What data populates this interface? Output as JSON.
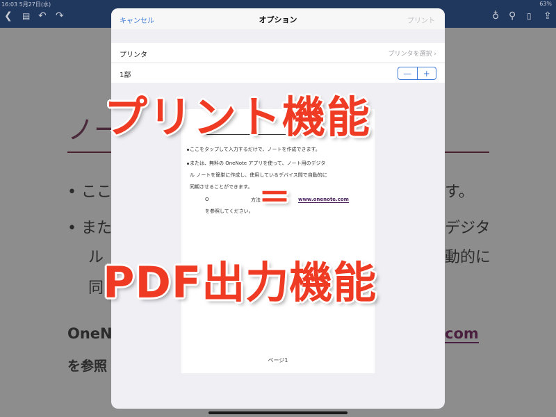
{
  "status_bar": {
    "time_date": "16:03  5月27日(水)",
    "right": "63%"
  },
  "toolbar": {
    "back_icon": "chevron-left-icon",
    "tabs_icon": "tabs-icon",
    "undo_icon": "undo-icon",
    "redo_icon": "redo-icon",
    "bulb_icon": "lightbulb-icon",
    "search_icon": "search-icon",
    "device_icon": "device-icon",
    "share_icon": "share-icon"
  },
  "background_page": {
    "title": "ノー",
    "bullet1_start": "•  ここ",
    "bullet1_end": "す。",
    "bullet2_start": "•  また",
    "bullet2_end": "デジタ",
    "line3_start": "ル",
    "line3_end": "動的に",
    "line4_start": "同",
    "onenote_start": "OneNo",
    "link_end": "com",
    "ref": "を参照"
  },
  "dialog": {
    "cancel": "キャンセル",
    "title": "オプション",
    "print": "プリント",
    "printer_label": "プリンタ",
    "printer_value": "プリンタを選択 ›",
    "copies_label": "1部",
    "minus": "—",
    "plus": "+"
  },
  "preview": {
    "bullet1": "ここをタップして入力するだけで、ノートを作成できます。",
    "bullet2a": "または、無料の OneNote アプリを使って、ノート用のデジタ",
    "bullet2b": "ル ノートを簡単に作成し、使用しているデバイス間で自動的に",
    "bullet2c": "同期させることができます。",
    "line4_start": "O",
    "line4_mid": "方法については、",
    "link": "www.onenote.com",
    "line5": "を参照してください。",
    "page_label": "ページ1"
  },
  "captions": {
    "top": "プリント機能",
    "equals": "＝",
    "bottom": "PDF出力機能"
  },
  "colors": {
    "accent": "#3d7bd9",
    "caption": "#ef3b24",
    "app_bar": "#20375e"
  }
}
